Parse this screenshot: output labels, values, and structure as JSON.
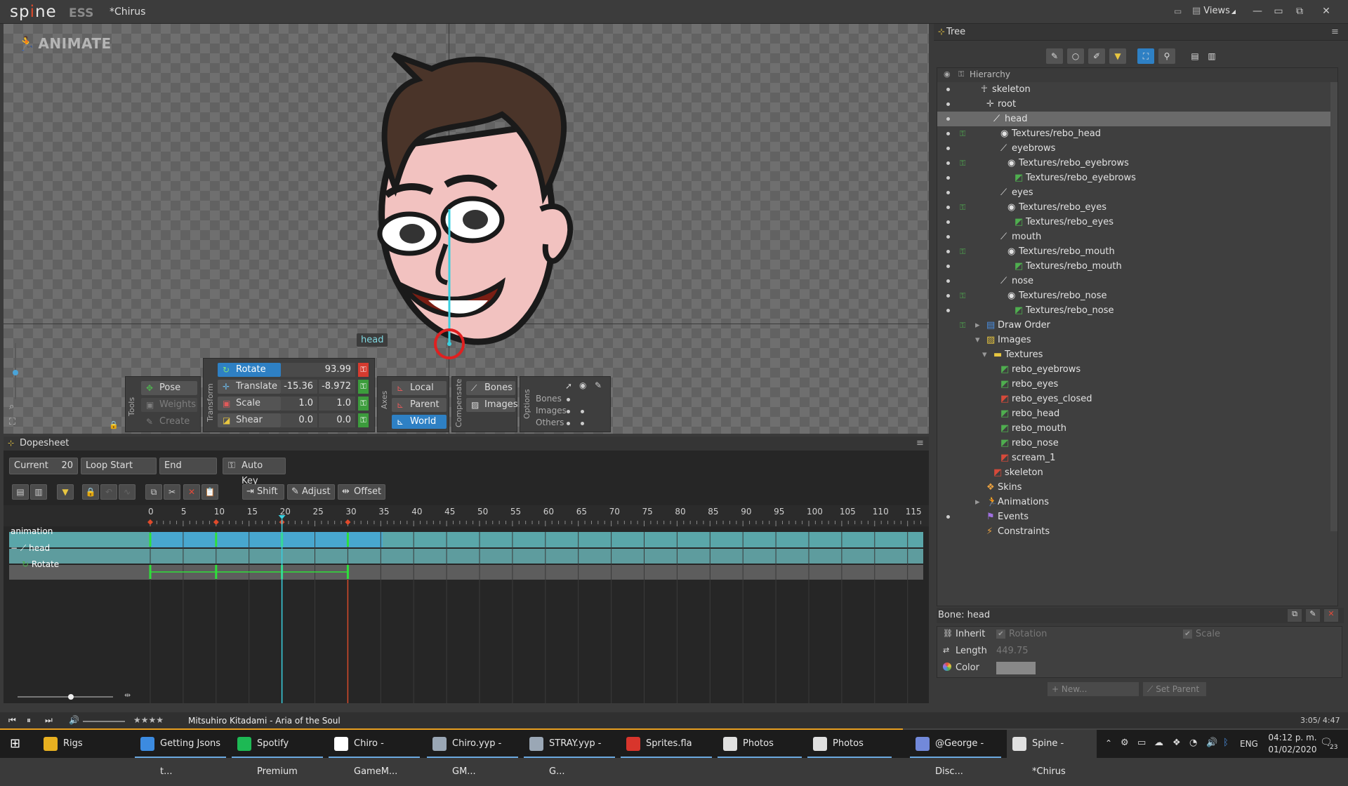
{
  "app": {
    "logo_a": "sp",
    "logo_o": "i",
    "logo_b": "ne",
    "edition": "ESS",
    "document_title": "*Chirus",
    "views_label": "Views"
  },
  "viewport": {
    "mode_label": "ANIMATE",
    "bone_label": "head"
  },
  "tools": {
    "title": "Tools",
    "pose": "Pose",
    "weights": "Weights",
    "create": "Create"
  },
  "transform": {
    "title": "Transform",
    "rotate": {
      "label": "Rotate",
      "value": "93.99"
    },
    "translate": {
      "label": "Translate",
      "x": "-15.36",
      "y": "-8.972"
    },
    "scale": {
      "label": "Scale",
      "x": "1.0",
      "y": "1.0"
    },
    "shear": {
      "label": "Shear",
      "x": "0.0",
      "y": "0.0"
    }
  },
  "axes": {
    "title": "Axes",
    "local": "Local",
    "parent": "Parent",
    "world": "World"
  },
  "compensate": {
    "title": "Compensate",
    "bones": "Bones",
    "images": "Images"
  },
  "options": {
    "title": "Options",
    "bones": "Bones",
    "images": "Images",
    "others": "Others"
  },
  "tree": {
    "title": "Tree",
    "hierarchy_label": "Hierarchy",
    "rows": [
      {
        "label": "skeleton"
      },
      {
        "label": "root"
      },
      {
        "label": "head"
      },
      {
        "label": "Textures/rebo_head"
      },
      {
        "label": "eyebrows"
      },
      {
        "label": "Textures/rebo_eyebrows"
      },
      {
        "label": "Textures/rebo_eyebrows"
      },
      {
        "label": "eyes"
      },
      {
        "label": "Textures/rebo_eyes"
      },
      {
        "label": "Textures/rebo_eyes"
      },
      {
        "label": "mouth"
      },
      {
        "label": "Textures/rebo_mouth"
      },
      {
        "label": "Textures/rebo_mouth"
      },
      {
        "label": "nose"
      },
      {
        "label": "Textures/rebo_nose"
      },
      {
        "label": "Textures/rebo_nose"
      },
      {
        "label": "Draw Order"
      },
      {
        "label": "Images"
      },
      {
        "label": "Textures"
      },
      {
        "label": "rebo_eyebrows"
      },
      {
        "label": "rebo_eyes"
      },
      {
        "label": "rebo_eyes_closed"
      },
      {
        "label": "rebo_head"
      },
      {
        "label": "rebo_mouth"
      },
      {
        "label": "rebo_nose"
      },
      {
        "label": "scream_1"
      },
      {
        "label": "skeleton"
      },
      {
        "label": "Skins"
      },
      {
        "label": "Animations"
      },
      {
        "label": "Events"
      },
      {
        "label": "Constraints"
      }
    ]
  },
  "bone_props": {
    "title": "Bone: head",
    "inherit": "Inherit",
    "rotation": "Rotation",
    "scale": "Scale",
    "length": "Length",
    "length_value": "449.75",
    "color": "Color",
    "new": "New...",
    "set_parent": "Set Parent"
  },
  "dopesheet": {
    "title": "Dopesheet",
    "current_label": "Current",
    "current_value": "20",
    "loop_start": "Loop Start",
    "end": "End",
    "auto_key": "Auto Key",
    "shift": "Shift",
    "adjust": "Adjust",
    "offset": "Offset",
    "ruler": [
      "0",
      "5",
      "10",
      "15",
      "20",
      "25",
      "30",
      "35",
      "40",
      "45",
      "50",
      "55",
      "60",
      "65",
      "70",
      "75",
      "80",
      "85",
      "90",
      "95",
      "100",
      "105",
      "110",
      "115"
    ],
    "rows": {
      "animation": "animation",
      "head": "head",
      "rotate": "Rotate"
    }
  },
  "media": {
    "stars": "★★★★",
    "track": "Mitsuhiro Kitadami - Aria of the Soul",
    "time": "3:05/ 4:47"
  },
  "taskbar": {
    "items": [
      {
        "label": "Rigs",
        "color": "#e8b020"
      },
      {
        "label": "Getting Jsons t...",
        "color": "#3c8be0"
      },
      {
        "label": "Spotify Premium",
        "color": "#1db954"
      },
      {
        "label": "Chiro - GameM...",
        "color": "#ffffff"
      },
      {
        "label": "Chiro.yyp - GM...",
        "color": "#9aa7b5"
      },
      {
        "label": "STRAY.yyp - G...",
        "color": "#9aa7b5"
      },
      {
        "label": "Sprites.fla",
        "color": "#d8352c"
      },
      {
        "label": "Photos",
        "color": "#e0e0e0"
      },
      {
        "label": "Photos",
        "color": "#e0e0e0"
      },
      {
        "label": "@George - Disc...",
        "color": "#7289da"
      },
      {
        "label": "Spine - *Chirus",
        "color": "#e0e0e0"
      }
    ],
    "lang": "ENG",
    "clock_time": "04:12 p. m.",
    "clock_date": "01/02/2020",
    "notif": "23"
  }
}
